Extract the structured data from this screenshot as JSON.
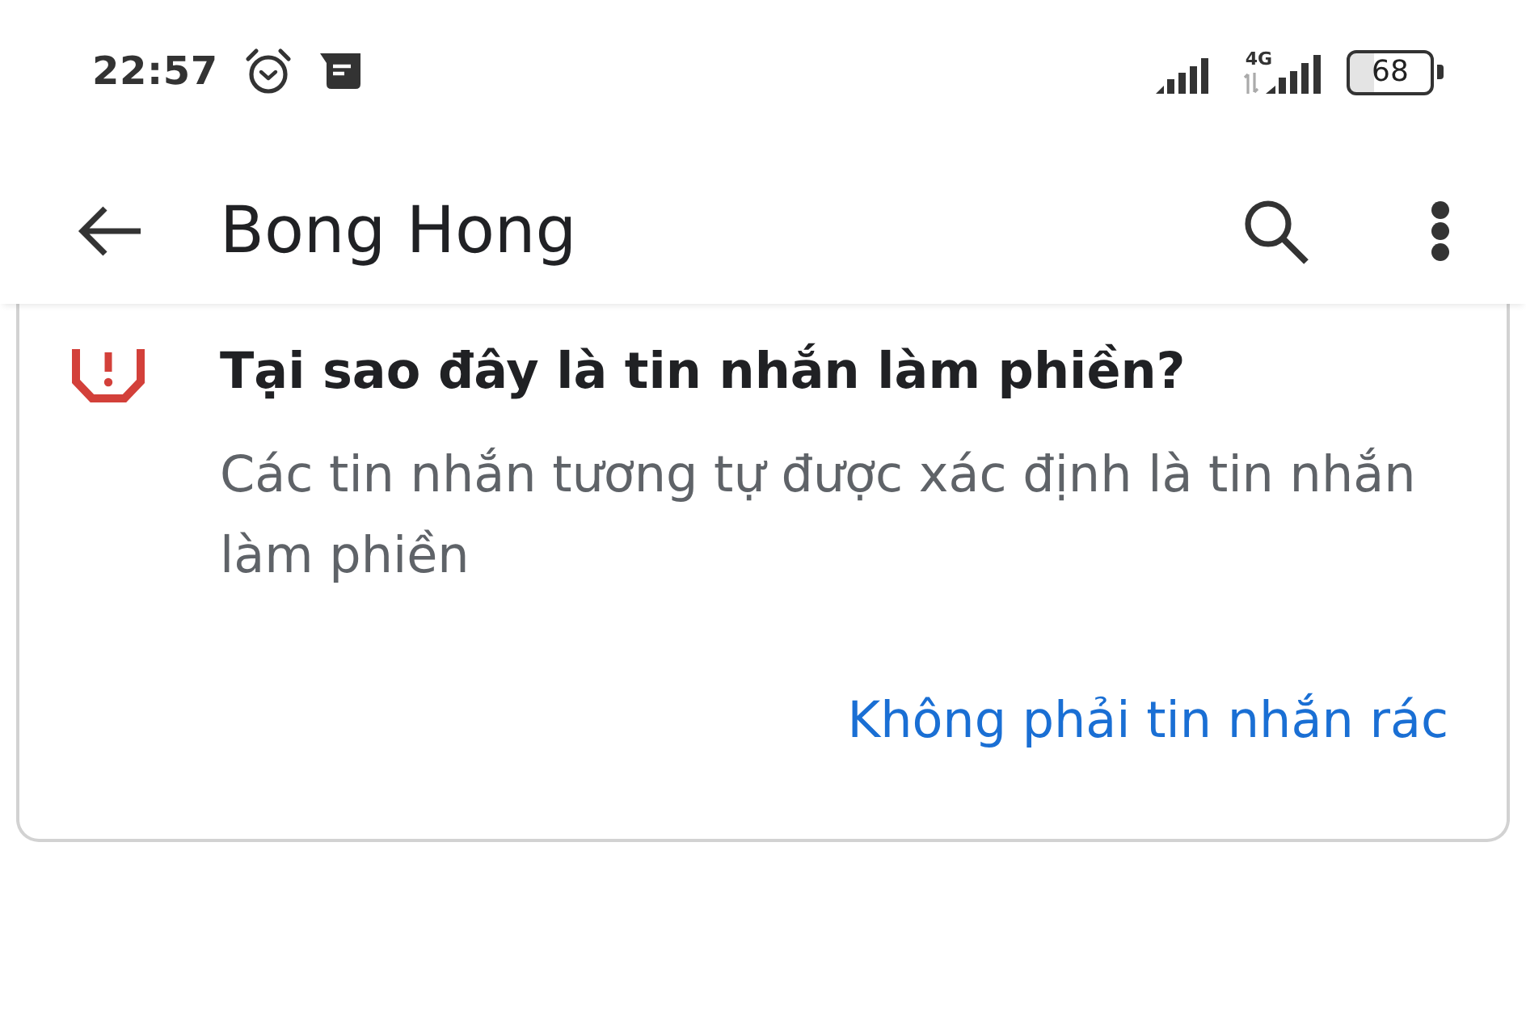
{
  "status_bar": {
    "time": "22:57",
    "network": "4G",
    "battery": "68"
  },
  "app_bar": {
    "title": "Bong Hong"
  },
  "spam_card": {
    "title": "Tại sao đây là tin nhắn làm phiền?",
    "body": "Các tin nhắn tương tự được xác định là tin nhắn làm phiền",
    "action": "Không phải tin nhắn rác"
  }
}
